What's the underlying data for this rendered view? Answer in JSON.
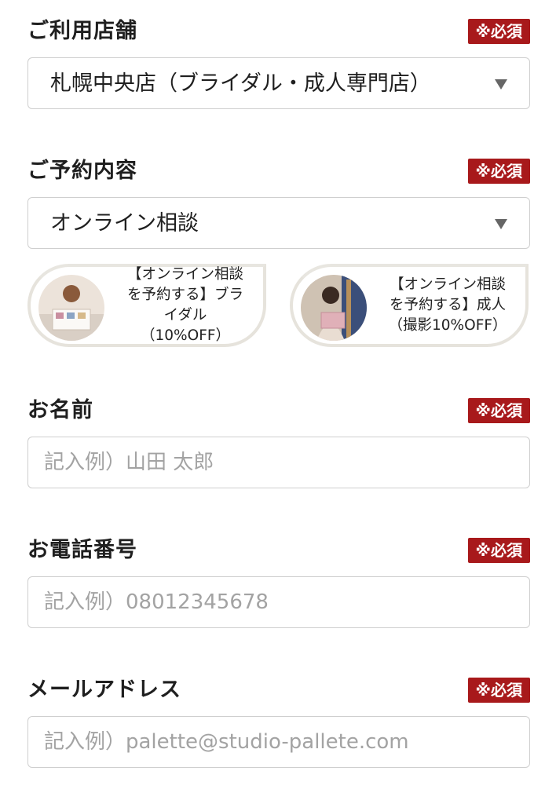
{
  "required_label": "※必須",
  "store": {
    "label": "ご利用店舗",
    "value": "札幌中央店（ブライダル・成人専門店）"
  },
  "reservation": {
    "label": "ご予約内容",
    "value": "オンライン相談"
  },
  "promos": [
    {
      "lines": [
        "【オンライン相談",
        "を予約する】ブラ",
        "イダル",
        "（10%OFF）"
      ]
    },
    {
      "lines": [
        "【オンライン相談",
        "を予約する】成人",
        "（撮影10%OFF）"
      ]
    }
  ],
  "name": {
    "label": "お名前",
    "placeholder": "記入例）山田 太郎"
  },
  "phone": {
    "label": "お電話番号",
    "placeholder": "記入例）08012345678"
  },
  "email": {
    "label": "メールアドレス",
    "placeholder": "記入例）palette@studio-pallete.com"
  },
  "colors": {
    "required_badge": "#a8191b",
    "border": "#cfcfcf",
    "promo_border": "#e6e3dc"
  }
}
